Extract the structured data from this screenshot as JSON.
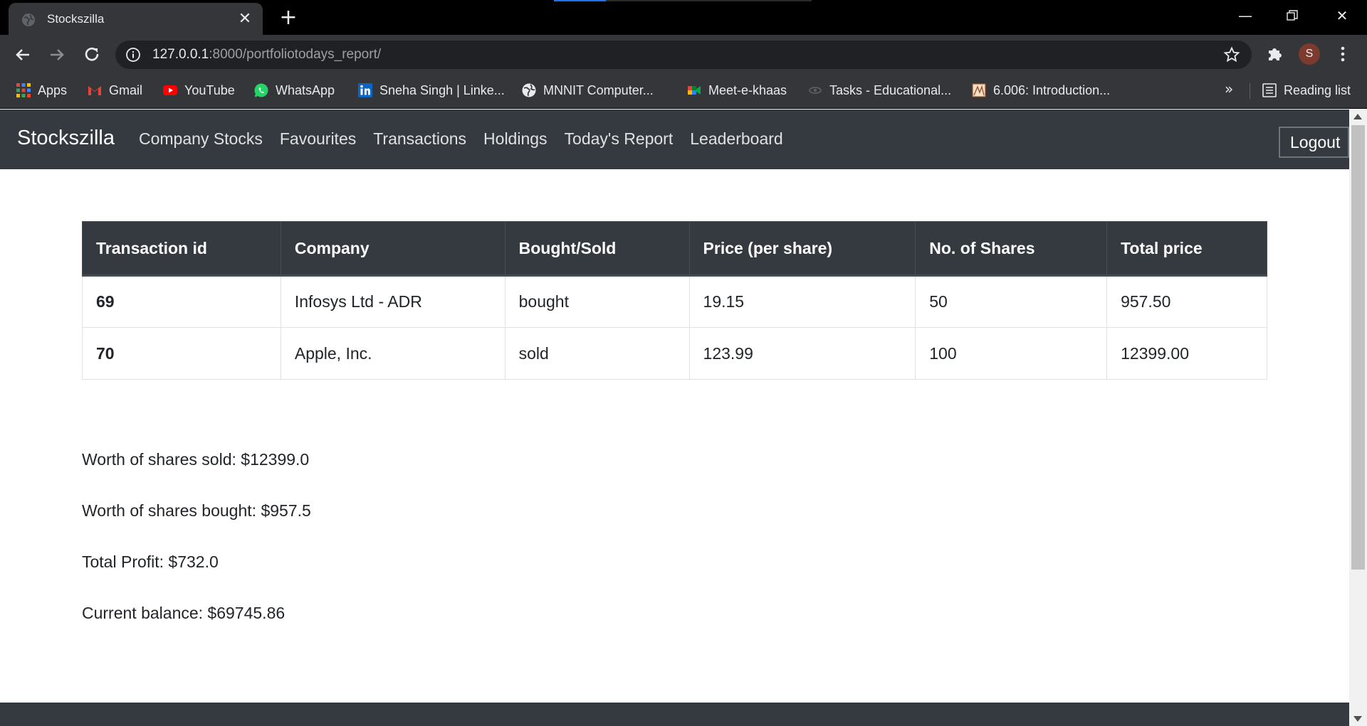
{
  "browser": {
    "tab_title": "Stockszilla",
    "url_host": "127.0.0.1",
    "url_rest": ":8000/portfoliotodays_report/",
    "profile_initial": "S",
    "bookmarks": [
      {
        "label": "Apps",
        "icon": "apps-grid-icon"
      },
      {
        "label": "Gmail",
        "icon": "gmail-icon"
      },
      {
        "label": "YouTube",
        "icon": "youtube-icon"
      },
      {
        "label": "WhatsApp",
        "icon": "whatsapp-icon"
      },
      {
        "label": "Sneha Singh | Linke...",
        "icon": "linkedin-icon"
      },
      {
        "label": "MNNIT Computer...",
        "icon": "globe-icon"
      },
      {
        "label": "Meet-e-khaas",
        "icon": "google-meet-icon"
      },
      {
        "label": "Tasks - Educational...",
        "icon": "tasks-icon"
      },
      {
        "label": "6.006: Introduction...",
        "icon": "mit-icon"
      }
    ],
    "more_bookmarks": "»",
    "reading_list": "Reading list"
  },
  "app": {
    "brand": "Stockszilla",
    "nav": [
      "Company Stocks",
      "Favourites",
      "Transactions",
      "Holdings",
      "Today's Report",
      "Leaderboard"
    ],
    "logout": "Logout"
  },
  "table": {
    "headers": [
      "Transaction id",
      "Company",
      "Bought/Sold",
      "Price (per share)",
      "No. of Shares",
      "Total price"
    ],
    "rows": [
      [
        "69",
        "Infosys Ltd - ADR",
        "bought",
        "19.15",
        "50",
        "957.50"
      ],
      [
        "70",
        "Apple, Inc.",
        "sold",
        "123.99",
        "100",
        "12399.00"
      ]
    ]
  },
  "summary": {
    "sold": "Worth of shares sold: $12399.0",
    "bought": "Worth of shares bought: $957.5",
    "profit": "Total Profit: $732.0",
    "balance": "Current balance: $69745.86"
  },
  "colors": {
    "navbar": "#343a40",
    "browser_chrome": "#35363a",
    "tab_strip": "#000000"
  }
}
